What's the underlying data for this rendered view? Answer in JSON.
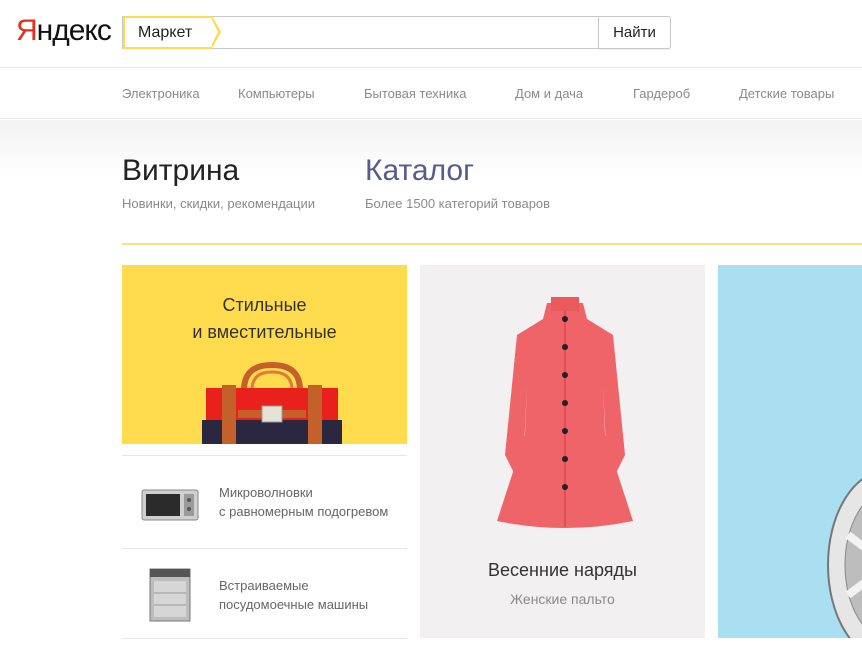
{
  "header": {
    "logo_first": "Я",
    "logo_rest": "ндекс",
    "search_tab": "Маркет",
    "search_value": "",
    "search_button": "Найти"
  },
  "nav": {
    "items": [
      "Электроника",
      "Компьютеры",
      "Бытовая техника",
      "Дом и дача",
      "Гардероб",
      "Детские товары"
    ]
  },
  "sections": {
    "showcase_title": "Витрина",
    "showcase_sub": "Новинки, скидки, рекомендации",
    "catalog_title": "Каталог",
    "catalog_sub": "Более 1500 категорий товаров"
  },
  "promo": {
    "line1": "Стильные",
    "line2": "и вместительные"
  },
  "list": [
    {
      "line1": "Микроволновки",
      "line2": "с равномерным подогревом",
      "icon": "microwave-icon"
    },
    {
      "line1": "Встраиваемые",
      "line2": "посудомоечные машины",
      "icon": "dishwasher-icon"
    }
  ],
  "coat_card": {
    "title": "Весенние наряды",
    "subtitle": "Женские пальто"
  },
  "colors": {
    "brand_red": "#e52d1b",
    "yellow": "#ffdb4d",
    "catalog_link": "#5a5a8c",
    "blue_card": "#a9dff0"
  }
}
